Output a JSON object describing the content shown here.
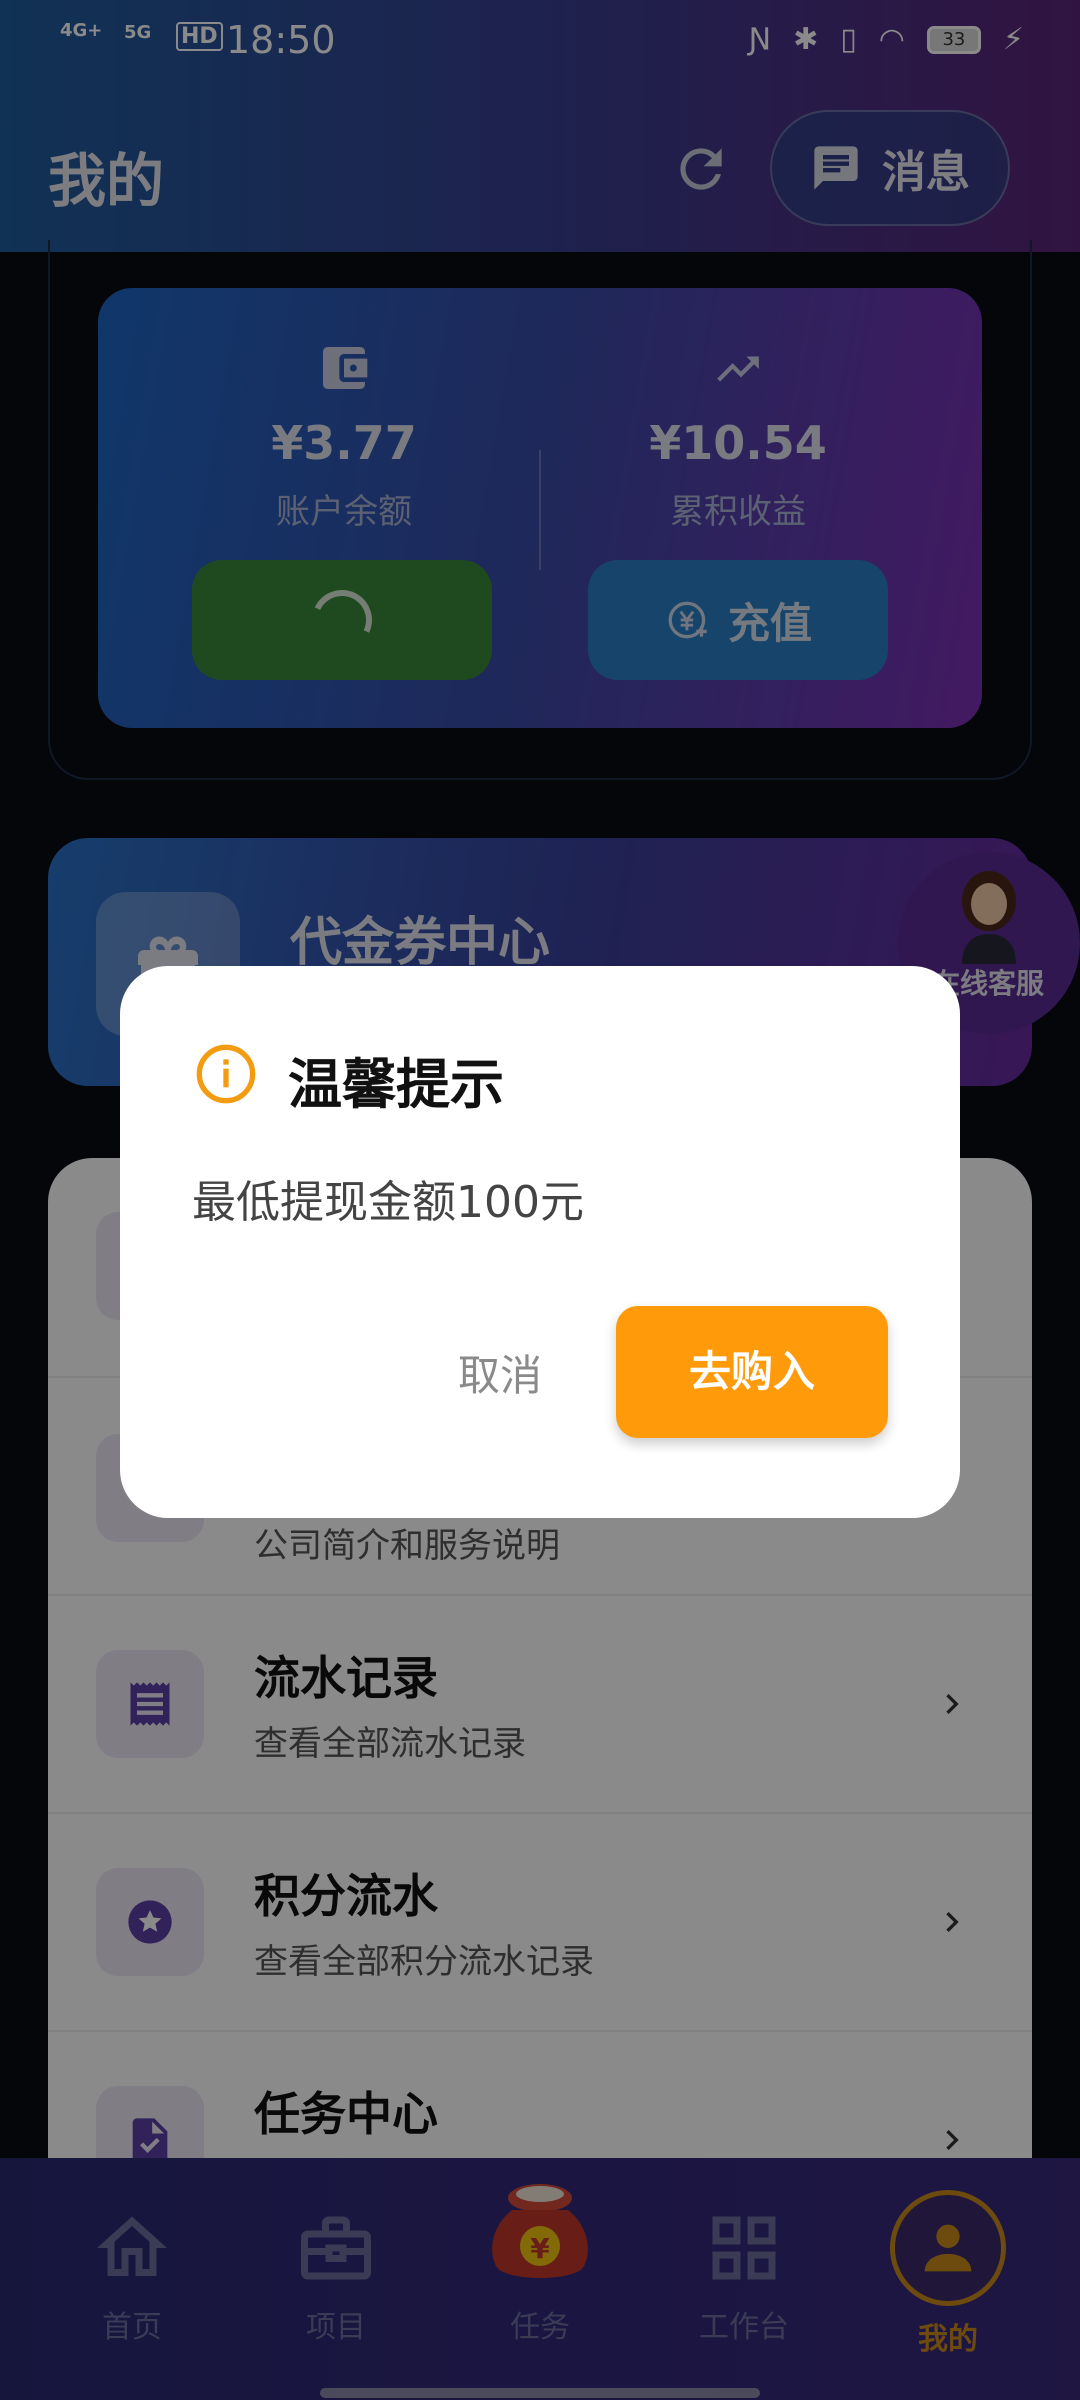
{
  "status_bar": {
    "network_left": "4G+",
    "network_right": "5G",
    "hd": "HD",
    "time": "18:50",
    "battery": "33"
  },
  "header": {
    "title": "我的",
    "message_label": "消息"
  },
  "wallet": {
    "balance_amount": "¥3.77",
    "balance_label": "账户余额",
    "earnings_amount": "¥10.54",
    "earnings_label": "累积收益",
    "recharge_label": "充值"
  },
  "voucher": {
    "title": "代金券中心"
  },
  "customer_service": {
    "label": "在线客服"
  },
  "list": {
    "rows": [
      {
        "title": "",
        "subtitle": ""
      },
      {
        "title": "",
        "subtitle": "公司简介和服务说明"
      },
      {
        "title": "流水记录",
        "subtitle": "查看全部流水记录"
      },
      {
        "title": "积分流水",
        "subtitle": "查看全部积分流水记录"
      },
      {
        "title": "任务中心",
        "subtitle": ""
      }
    ]
  },
  "dialog": {
    "title": "温馨提示",
    "message": "最低提现金额100元",
    "cancel_label": "取消",
    "confirm_label": "去购入"
  },
  "bottom_nav": {
    "items": [
      {
        "label": "首页",
        "icon": "home-icon"
      },
      {
        "label": "项目",
        "icon": "briefcase-icon"
      },
      {
        "label": "任务",
        "icon": "money-bag-icon"
      },
      {
        "label": "工作台",
        "icon": "dashboard-icon"
      },
      {
        "label": "我的",
        "icon": "profile-icon"
      }
    ],
    "active_index": 4
  },
  "colors": {
    "accent_orange": "#ff9a0a",
    "active_nav": "#c98a1a",
    "withdraw_green": "#3a8a3a",
    "recharge_blue": "#2a7fc4"
  }
}
